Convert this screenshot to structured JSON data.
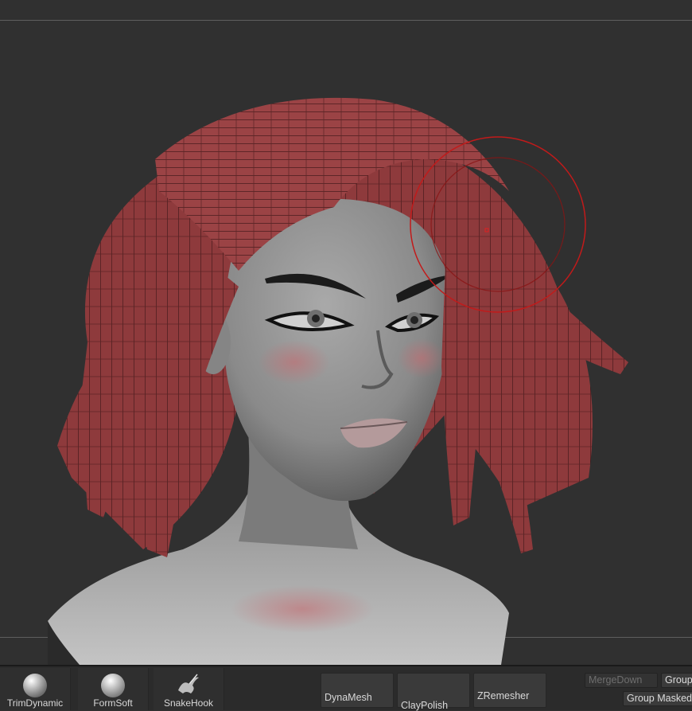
{
  "viewport": {
    "background": "#303030",
    "hair_color": "#8e3a3c",
    "skin_color": "#8c8c8c",
    "cursor_color": "#c21a1a"
  },
  "shelf": {
    "brushes": [
      {
        "label": "TrimDynamic",
        "icon": "sphere-brush-icon"
      },
      {
        "label": "FormSoft",
        "icon": "sphere-brush-icon"
      },
      {
        "label": "SnakeHook",
        "icon": "snakehook-brush-icon"
      }
    ],
    "actions": [
      {
        "label": "DynaMesh"
      },
      {
        "label": "ClayPolish"
      },
      {
        "label": "ZRemesher"
      }
    ],
    "subtool": {
      "merge_down": "MergeDown",
      "group_visible": "Group",
      "group_masked": "Group Masked"
    }
  }
}
